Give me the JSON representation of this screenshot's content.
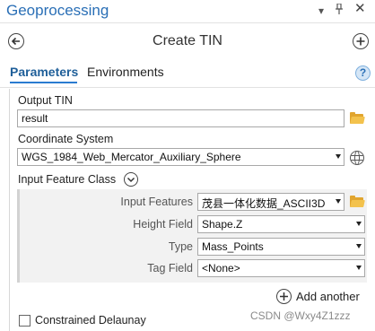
{
  "window": {
    "title": "Geoprocessing"
  },
  "tool": {
    "title": "Create TIN"
  },
  "tabs": [
    {
      "label": "Parameters",
      "active": true
    },
    {
      "label": "Environments",
      "active": false
    }
  ],
  "help": {
    "glyph": "?"
  },
  "output_tin": {
    "label": "Output TIN",
    "value": "result"
  },
  "coordinate_system": {
    "label": "Coordinate System",
    "value": "WGS_1984_Web_Mercator_Auxiliary_Sphere"
  },
  "input_feature_class": {
    "label": "Input Feature Class",
    "rows": [
      {
        "label": "Input Features",
        "value": "茂县一体化数据_ASCII3D"
      },
      {
        "label": "Height Field",
        "value": "Shape.Z"
      },
      {
        "label": "Type",
        "value": "Mass_Points"
      },
      {
        "label": "Tag Field",
        "value": "<None>"
      }
    ],
    "add_another_label": "Add another"
  },
  "constrained_delaunay": {
    "label": "Constrained Delaunay",
    "checked": false
  },
  "watermark": "CSDN @Wxy4Z1zzz",
  "colors": {
    "accent": "#2a6fb6",
    "tab_underline": "#2a7bd0",
    "folder": "#f3c24d"
  },
  "icons": [
    "chevron-down-icon",
    "pin-icon",
    "close-icon",
    "back-arrow-icon",
    "add-icon",
    "help-icon",
    "folder-icon",
    "globe-icon",
    "collapse-icon",
    "dropdown-arrow-icon"
  ]
}
